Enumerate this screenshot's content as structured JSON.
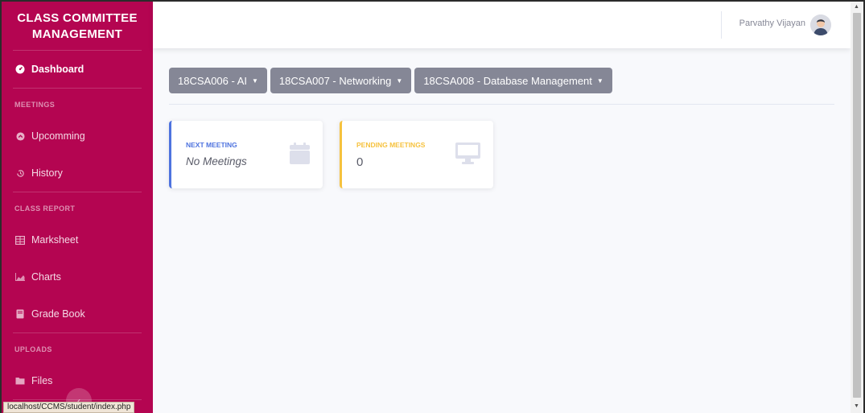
{
  "sidebar": {
    "brand_line1": "CLASS COMMITTEE",
    "brand_line2": "MANAGEMENT",
    "dashboard": "Dashboard",
    "heading_meetings": "MEETINGS",
    "upcomming": "Upcomming",
    "history": "History",
    "heading_class_report": "CLASS REPORT",
    "marksheet": "Marksheet",
    "charts": "Charts",
    "grade_book": "Grade Book",
    "heading_uploads": "UPLOADS",
    "files": "Files"
  },
  "topbar": {
    "user_name": "Parvathy Vijayan"
  },
  "subjects": [
    "18CSA006 - AI",
    "18CSA007 - Networking",
    "18CSA008 - Database Management"
  ],
  "cards": {
    "next_meeting_label": "NEXT MEETING",
    "next_meeting_value": "No Meetings",
    "pending_label": "PENDING MEETINGS",
    "pending_value": "0"
  },
  "status_url": "localhost/CCMS/student/index.php",
  "colors": {
    "sidebar": "#b40551",
    "primary": "#4e73df",
    "warning": "#f6c23e",
    "secondary": "#858796"
  }
}
